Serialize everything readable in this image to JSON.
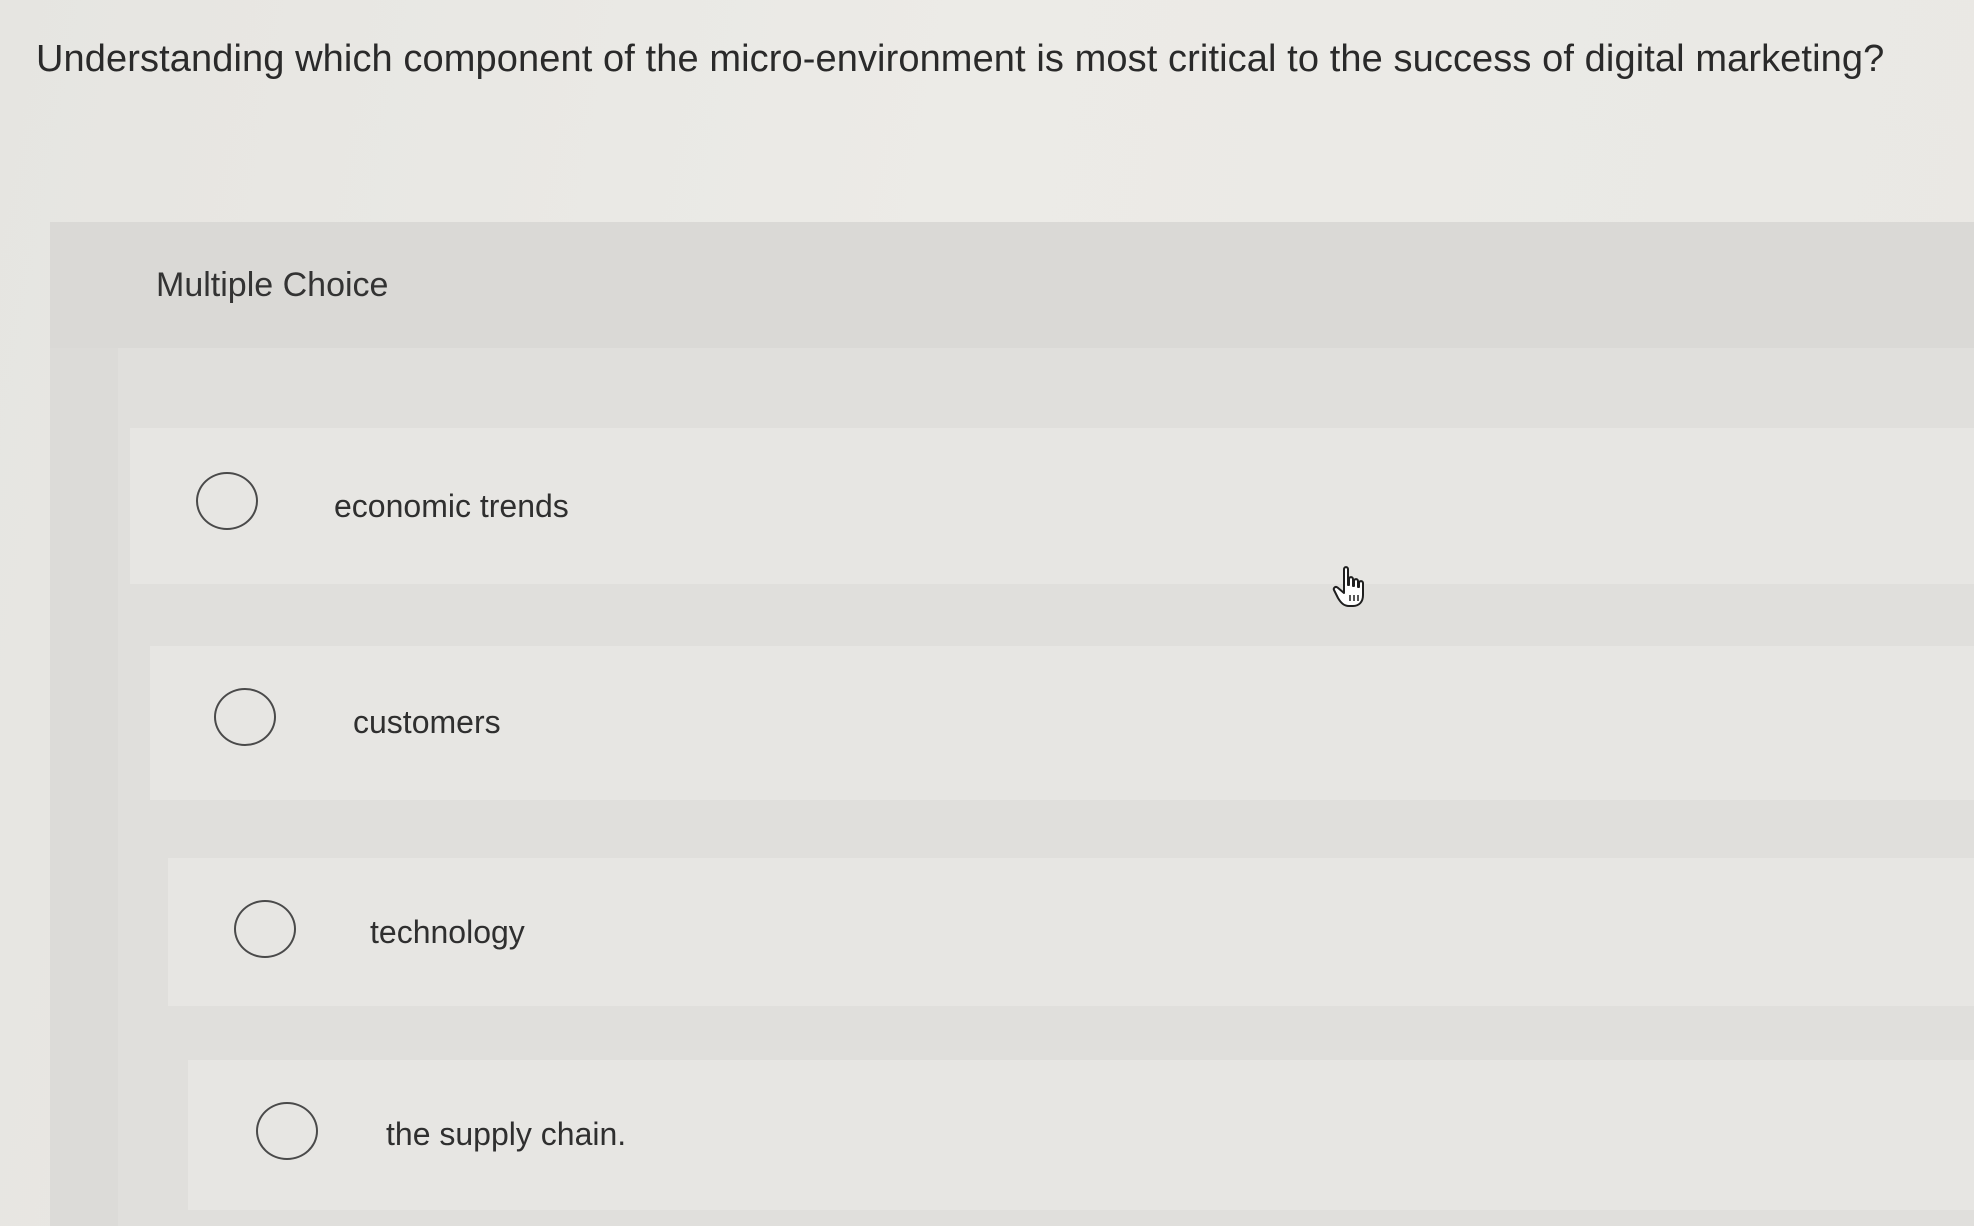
{
  "question": {
    "text": "Understanding which component of the micro-environment is most critical to the success of digital marketing?"
  },
  "question_type": "Multiple Choice",
  "options": [
    {
      "label": "economic trends",
      "selected": false
    },
    {
      "label": "customers",
      "selected": false
    },
    {
      "label": "technology",
      "selected": false
    },
    {
      "label": "the supply chain.",
      "selected": false
    }
  ],
  "icons": {
    "radio": "radio-empty-circle-icon",
    "cursor": "hand-pointer-icon"
  },
  "colors": {
    "background": "#ebeae6",
    "panel": "#dcdbd8",
    "option": "#e7e6e3",
    "text": "#2b2b2b"
  }
}
